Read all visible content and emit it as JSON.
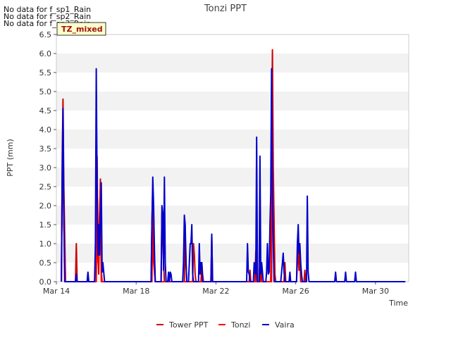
{
  "notes": [
    "No data for f_sp1_Rain",
    "No data for f_sp2_Rain",
    "No data for f_sp3_Rain"
  ],
  "badge": "TZ_mixed",
  "chart_data": {
    "type": "line",
    "title": "Tonzi PPT",
    "xlabel": "Time",
    "ylabel": "PPT (mm)",
    "xlim": [
      "2024-03-14",
      "2024-03-31 16:00"
    ],
    "ylim": [
      0,
      6.5
    ],
    "x_ticks": [
      {
        "label": "Mar 14",
        "date": "2024-03-14"
      },
      {
        "label": "Mar 18",
        "date": "2024-03-18"
      },
      {
        "label": "Mar 22",
        "date": "2024-03-22"
      },
      {
        "label": "Mar 26",
        "date": "2024-03-26"
      },
      {
        "label": "Mar 30",
        "date": "2024-03-30"
      }
    ],
    "y_ticks": [
      "0.0",
      "0.5",
      "1.0",
      "1.5",
      "2.0",
      "2.5",
      "3.0",
      "3.5",
      "4.0",
      "4.5",
      "5.0",
      "5.5",
      "6.0",
      "6.5"
    ],
    "grid": "horizontal bands",
    "legend_position": "bottom-center",
    "series": [
      {
        "name": "Tower PPT",
        "color": "#cc0000",
        "points": [
          [
            "2024-03-14 06:00",
            0
          ],
          [
            "2024-03-14 07:00",
            3.3
          ],
          [
            "2024-03-14 08:00",
            4.8
          ],
          [
            "2024-03-14 09:00",
            2.5
          ],
          [
            "2024-03-14 11:00",
            0
          ],
          [
            "2024-03-14 23:00",
            0
          ],
          [
            "2024-03-15 00:00",
            1.0
          ],
          [
            "2024-03-15 01:00",
            0
          ],
          [
            "2024-03-15 22:00",
            0
          ],
          [
            "2024-03-15 23:00",
            0.3
          ],
          [
            "2024-03-16 00:00",
            1.5
          ],
          [
            "2024-03-16 01:00",
            3.3
          ],
          [
            "2024-03-16 02:00",
            0.7
          ],
          [
            "2024-03-16 03:00",
            0.2
          ],
          [
            "2024-03-16 04:00",
            1.7
          ],
          [
            "2024-03-16 05:00",
            2.7
          ],
          [
            "2024-03-16 06:00",
            0.3
          ],
          [
            "2024-03-16 07:00",
            0
          ],
          [
            "2024-03-18 18:00",
            0
          ],
          [
            "2024-03-18 19:00",
            1.6
          ],
          [
            "2024-03-18 20:00",
            2.5
          ],
          [
            "2024-03-18 21:00",
            1.3
          ],
          [
            "2024-03-18 23:00",
            0
          ],
          [
            "2024-03-19 06:00",
            0
          ],
          [
            "2024-03-19 07:00",
            1.8
          ],
          [
            "2024-03-19 09:00",
            0.5
          ],
          [
            "2024-03-19 10:00",
            0
          ],
          [
            "2024-03-20 10:00",
            0
          ],
          [
            "2024-03-20 11:00",
            1.2
          ],
          [
            "2024-03-20 12:00",
            0.5
          ],
          [
            "2024-03-20 13:00",
            0
          ],
          [
            "2024-03-20 20:00",
            0
          ],
          [
            "2024-03-20 21:00",
            1.0
          ],
          [
            "2024-03-20 22:00",
            0.7
          ],
          [
            "2024-03-20 23:00",
            0.2
          ],
          [
            "2024-03-21 00:00",
            0
          ],
          [
            "2024-03-21 06:00",
            0
          ],
          [
            "2024-03-21 07:00",
            0.5
          ],
          [
            "2024-03-21 08:00",
            0.2
          ],
          [
            "2024-03-21 09:00",
            0
          ],
          [
            "2024-03-21 18:00",
            0
          ],
          [
            "2024-03-21 19:00",
            1.2
          ],
          [
            "2024-03-21 20:00",
            0
          ],
          [
            "2024-03-23 16:00",
            0
          ],
          [
            "2024-03-23 17:00",
            0.3
          ],
          [
            "2024-03-23 18:00",
            0
          ],
          [
            "2024-03-23 23:00",
            0
          ],
          [
            "2024-03-24 00:00",
            0.8
          ],
          [
            "2024-03-24 01:00",
            0
          ],
          [
            "2024-03-24 05:00",
            0
          ],
          [
            "2024-03-24 06:00",
            0.5
          ],
          [
            "2024-03-24 07:00",
            0
          ],
          [
            "2024-03-24 18:00",
            0
          ],
          [
            "2024-03-24 19:00",
            3.5
          ],
          [
            "2024-03-24 20:00",
            6.1
          ],
          [
            "2024-03-24 21:00",
            3.0
          ],
          [
            "2024-03-24 22:00",
            1.5
          ],
          [
            "2024-03-24 23:00",
            0.2
          ],
          [
            "2024-03-25 00:00",
            0
          ],
          [
            "2024-03-25 10:00",
            0
          ],
          [
            "2024-03-25 11:00",
            0.5
          ],
          [
            "2024-03-25 12:00",
            0
          ],
          [
            "2024-03-26 01:00",
            0
          ],
          [
            "2024-03-26 02:00",
            0.5
          ],
          [
            "2024-03-26 03:00",
            1.0
          ],
          [
            "2024-03-26 04:00",
            0.3
          ],
          [
            "2024-03-26 05:00",
            0.8
          ],
          [
            "2024-03-26 06:00",
            0
          ],
          [
            "2024-03-26 10:00",
            0
          ],
          [
            "2024-03-26 11:00",
            0.3
          ],
          [
            "2024-03-26 12:00",
            0
          ]
        ]
      },
      {
        "name": "Tonzi",
        "color": "#ff0000",
        "points": [
          [
            "2024-03-14 06:00",
            0
          ],
          [
            "2024-03-14 07:00",
            2.2
          ],
          [
            "2024-03-14 08:00",
            4.0
          ],
          [
            "2024-03-14 09:00",
            1.5
          ],
          [
            "2024-03-14 11:00",
            0
          ],
          [
            "2024-03-16 00:00",
            0
          ],
          [
            "2024-03-16 01:00",
            2.5
          ],
          [
            "2024-03-16 02:00",
            0.5
          ],
          [
            "2024-03-16 05:00",
            2.5
          ],
          [
            "2024-03-16 06:00",
            0
          ],
          [
            "2024-03-18 19:00",
            0
          ],
          [
            "2024-03-18 20:00",
            2.0
          ],
          [
            "2024-03-18 21:00",
            0.5
          ],
          [
            "2024-03-18 23:00",
            0
          ],
          [
            "2024-03-24 19:00",
            0
          ],
          [
            "2024-03-24 20:00",
            5.5
          ],
          [
            "2024-03-24 21:00",
            2.0
          ],
          [
            "2024-03-24 22:00",
            0
          ]
        ]
      },
      {
        "name": "Vaira",
        "color": "#0000cc",
        "points": [
          [
            "2024-03-14 06:00",
            0
          ],
          [
            "2024-03-14 07:00",
            2.8
          ],
          [
            "2024-03-14 08:00",
            4.55
          ],
          [
            "2024-03-14 09:00",
            1.8
          ],
          [
            "2024-03-14 10:00",
            0
          ],
          [
            "2024-03-14 23:00",
            0
          ],
          [
            "2024-03-15 00:00",
            0.2
          ],
          [
            "2024-03-15 01:00",
            0
          ],
          [
            "2024-03-15 13:00",
            0
          ],
          [
            "2024-03-15 14:00",
            0.25
          ],
          [
            "2024-03-15 15:00",
            0
          ],
          [
            "2024-03-15 22:00",
            0
          ],
          [
            "2024-03-15 23:00",
            1.0
          ],
          [
            "2024-03-16 00:00",
            5.6
          ],
          [
            "2024-03-16 01:00",
            2.5
          ],
          [
            "2024-03-16 02:00",
            0.7
          ],
          [
            "2024-03-16 03:00",
            1.5
          ],
          [
            "2024-03-16 04:00",
            0.7
          ],
          [
            "2024-03-16 05:00",
            1.75
          ],
          [
            "2024-03-16 06:00",
            2.6
          ],
          [
            "2024-03-16 07:00",
            0.25
          ],
          [
            "2024-03-16 08:00",
            0.5
          ],
          [
            "2024-03-16 09:00",
            0.25
          ],
          [
            "2024-03-16 10:00",
            0
          ],
          [
            "2024-03-18 18:00",
            0
          ],
          [
            "2024-03-18 19:00",
            1.5
          ],
          [
            "2024-03-18 20:00",
            2.75
          ],
          [
            "2024-03-18 21:00",
            2.0
          ],
          [
            "2024-03-18 22:00",
            0.8
          ],
          [
            "2024-03-18 23:00",
            0
          ],
          [
            "2024-03-19 06:00",
            0
          ],
          [
            "2024-03-19 07:00",
            2.0
          ],
          [
            "2024-03-19 08:00",
            1.8
          ],
          [
            "2024-03-19 09:00",
            0.3
          ],
          [
            "2024-03-19 10:00",
            2.75
          ],
          [
            "2024-03-19 11:00",
            0.5
          ],
          [
            "2024-03-19 12:00",
            0
          ],
          [
            "2024-03-19 14:00",
            0
          ],
          [
            "2024-03-19 15:00",
            0.25
          ],
          [
            "2024-03-19 16:00",
            0
          ],
          [
            "2024-03-19 17:00",
            0.25
          ],
          [
            "2024-03-19 18:00",
            0.2
          ],
          [
            "2024-03-19 19:00",
            0
          ],
          [
            "2024-03-20 08:00",
            0
          ],
          [
            "2024-03-20 09:00",
            0.5
          ],
          [
            "2024-03-20 10:00",
            1.75
          ],
          [
            "2024-03-20 11:00",
            1.5
          ],
          [
            "2024-03-20 12:00",
            0.5
          ],
          [
            "2024-03-20 13:00",
            0
          ],
          [
            "2024-03-20 15:00",
            0
          ],
          [
            "2024-03-20 16:00",
            0.5
          ],
          [
            "2024-03-20 17:00",
            1.0
          ],
          [
            "2024-03-20 18:00",
            1.0
          ],
          [
            "2024-03-20 19:00",
            1.5
          ],
          [
            "2024-03-20 20:00",
            0.2
          ],
          [
            "2024-03-20 21:00",
            0
          ],
          [
            "2024-03-21 03:00",
            0
          ],
          [
            "2024-03-21 04:00",
            1.0
          ],
          [
            "2024-03-21 05:00",
            0.2
          ],
          [
            "2024-03-21 06:00",
            0.5
          ],
          [
            "2024-03-21 07:00",
            0.5
          ],
          [
            "2024-03-21 08:00",
            0
          ],
          [
            "2024-03-21 18:00",
            0
          ],
          [
            "2024-03-21 19:00",
            1.25
          ],
          [
            "2024-03-21 20:00",
            0
          ],
          [
            "2024-03-23 13:00",
            0
          ],
          [
            "2024-03-23 14:00",
            1.0
          ],
          [
            "2024-03-23 15:00",
            0.25
          ],
          [
            "2024-03-23 16:00",
            0.2
          ],
          [
            "2024-03-23 17:00",
            0
          ],
          [
            "2024-03-23 21:00",
            0
          ],
          [
            "2024-03-23 22:00",
            0.5
          ],
          [
            "2024-03-23 23:00",
            0.25
          ],
          [
            "2024-03-24 00:00",
            0.2
          ],
          [
            "2024-03-24 01:00",
            3.8
          ],
          [
            "2024-03-24 02:00",
            0
          ],
          [
            "2024-03-24 04:00",
            0
          ],
          [
            "2024-03-24 05:00",
            3.3
          ],
          [
            "2024-03-24 06:00",
            0.2
          ],
          [
            "2024-03-24 07:00",
            0.5
          ],
          [
            "2024-03-24 08:00",
            0.25
          ],
          [
            "2024-03-24 09:00",
            0
          ],
          [
            "2024-03-24 12:00",
            0
          ],
          [
            "2024-03-24 13:00",
            0.25
          ],
          [
            "2024-03-24 14:00",
            1.0
          ],
          [
            "2024-03-24 15:00",
            0.2
          ],
          [
            "2024-03-24 16:00",
            0.25
          ],
          [
            "2024-03-24 17:00",
            1.5
          ],
          [
            "2024-03-24 18:00",
            2.3
          ],
          [
            "2024-03-24 19:00",
            5.6
          ],
          [
            "2024-03-24 20:00",
            2.5
          ],
          [
            "2024-03-24 21:00",
            1.0
          ],
          [
            "2024-03-24 22:00",
            0
          ],
          [
            "2024-03-25 06:00",
            0
          ],
          [
            "2024-03-25 07:00",
            0.25
          ],
          [
            "2024-03-25 08:00",
            0.5
          ],
          [
            "2024-03-25 09:00",
            0.75
          ],
          [
            "2024-03-25 10:00",
            0.25
          ],
          [
            "2024-03-25 11:00",
            0
          ],
          [
            "2024-03-25 16:00",
            0
          ],
          [
            "2024-03-25 17:00",
            0.25
          ],
          [
            "2024-03-25 18:00",
            0
          ],
          [
            "2024-03-26 01:00",
            0
          ],
          [
            "2024-03-26 02:00",
            1.0
          ],
          [
            "2024-03-26 03:00",
            1.5
          ],
          [
            "2024-03-26 04:00",
            0.75
          ],
          [
            "2024-03-26 05:00",
            1.0
          ],
          [
            "2024-03-26 06:00",
            0.5
          ],
          [
            "2024-03-26 07:00",
            0.2
          ],
          [
            "2024-03-26 08:00",
            0
          ],
          [
            "2024-03-26 13:00",
            0
          ],
          [
            "2024-03-26 14:00",
            2.25
          ],
          [
            "2024-03-26 15:00",
            0.25
          ],
          [
            "2024-03-26 16:00",
            0
          ],
          [
            "2024-03-27 23:00",
            0
          ],
          [
            "2024-03-28 00:00",
            0.25
          ],
          [
            "2024-03-28 01:00",
            0
          ],
          [
            "2024-03-28 11:00",
            0
          ],
          [
            "2024-03-28 12:00",
            0.25
          ],
          [
            "2024-03-28 13:00",
            0
          ],
          [
            "2024-03-28 23:00",
            0
          ],
          [
            "2024-03-29 00:00",
            0.25
          ],
          [
            "2024-03-29 01:00",
            0
          ],
          [
            "2024-03-31 12:00",
            0
          ]
        ]
      }
    ]
  }
}
